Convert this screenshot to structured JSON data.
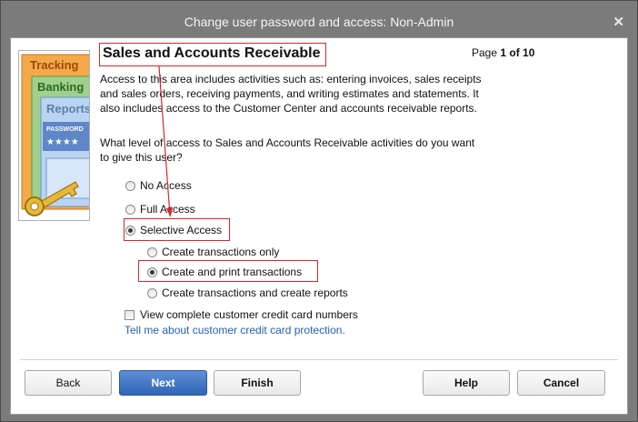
{
  "window": {
    "title": "Change user password and access: Non-Admin",
    "close_glyph": "✕"
  },
  "art": {
    "labels": [
      "Tracking",
      "Banking",
      "Reports"
    ],
    "password_label": "PASSWORD",
    "password_mask": "★★★★"
  },
  "section": {
    "heading": "Sales and Accounts Receivable",
    "page_prefix": "Page",
    "page_value": "1 of 10",
    "description": "Access to this area includes activities such as: entering invoices, sales receipts and sales orders, receiving payments, and writing estimates and statements. It also includes access to the Customer Center and accounts receivable reports.",
    "question": "What level of access to Sales and Accounts Receivable activities do you want to give this user?"
  },
  "options": {
    "no_access": "No Access",
    "full_access": "Full Access",
    "selective_access": "Selective Access",
    "create_only": "Create transactions only",
    "create_print": "Create and print transactions",
    "create_reports": "Create transactions and create reports",
    "selected": "Selective Access",
    "selected_sub": "Create and print transactions"
  },
  "credit_card": {
    "checkbox_label": "View complete customer credit card numbers",
    "checked": false,
    "link": "Tell me about customer credit card protection."
  },
  "buttons": {
    "back": "Back",
    "next": "Next",
    "finish": "Finish",
    "help": "Help",
    "cancel": "Cancel"
  },
  "colors": {
    "annotation_red": "#d9262d",
    "primary_blue": "#3a6fc0",
    "link_blue": "#2461b0"
  }
}
